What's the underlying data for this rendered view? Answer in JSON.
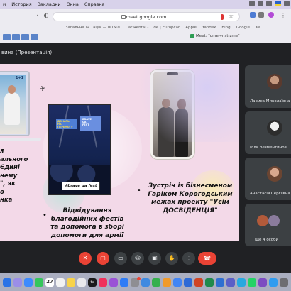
{
  "menubar": {
    "items": [
      "и",
      "История",
      "Закладки",
      "Окна",
      "Справка"
    ]
  },
  "browser": {
    "url": "meet.google.com",
    "bookmarks": [
      "Загальна ін...ація — ФТМЛ",
      "Car Rental - ...de | Europcar",
      "Apple",
      "Yandex",
      "Bing",
      "Google",
      "Ka"
    ],
    "meet_tab": "Meet: \"ome-vnst-zme\""
  },
  "meet": {
    "presenter": "вина (Презентація)",
    "slide": {
      "left_text": "я\nального\nЄдині\nнему\n\", як\nо\nнка",
      "laptop_logo": "1+1",
      "concert_screen1": "ДОНАТЬ\nНА ПЕРЕМОГУ",
      "concert_screen2": "BRAVE\nUA\nFEST",
      "concert_tag": "#brave ua fest",
      "mid_text": "Відвідування благодійних фестів та допомога в зборі допомоги для армії",
      "right_text": "Зустріч із бізнесменом Гаріком Корогодським межах проекту \"Усім ДОСВІДЕНЦІЯ\""
    },
    "participants": [
      {
        "name": "Лариса Миколаївна"
      },
      {
        "name": "Ілля Везментинов"
      },
      {
        "name": "Анастасія Сергіївна"
      },
      {
        "name": "Ще 4 особи"
      }
    ]
  },
  "dock": {
    "calendar_day": "27",
    "tv_label": "tv"
  }
}
